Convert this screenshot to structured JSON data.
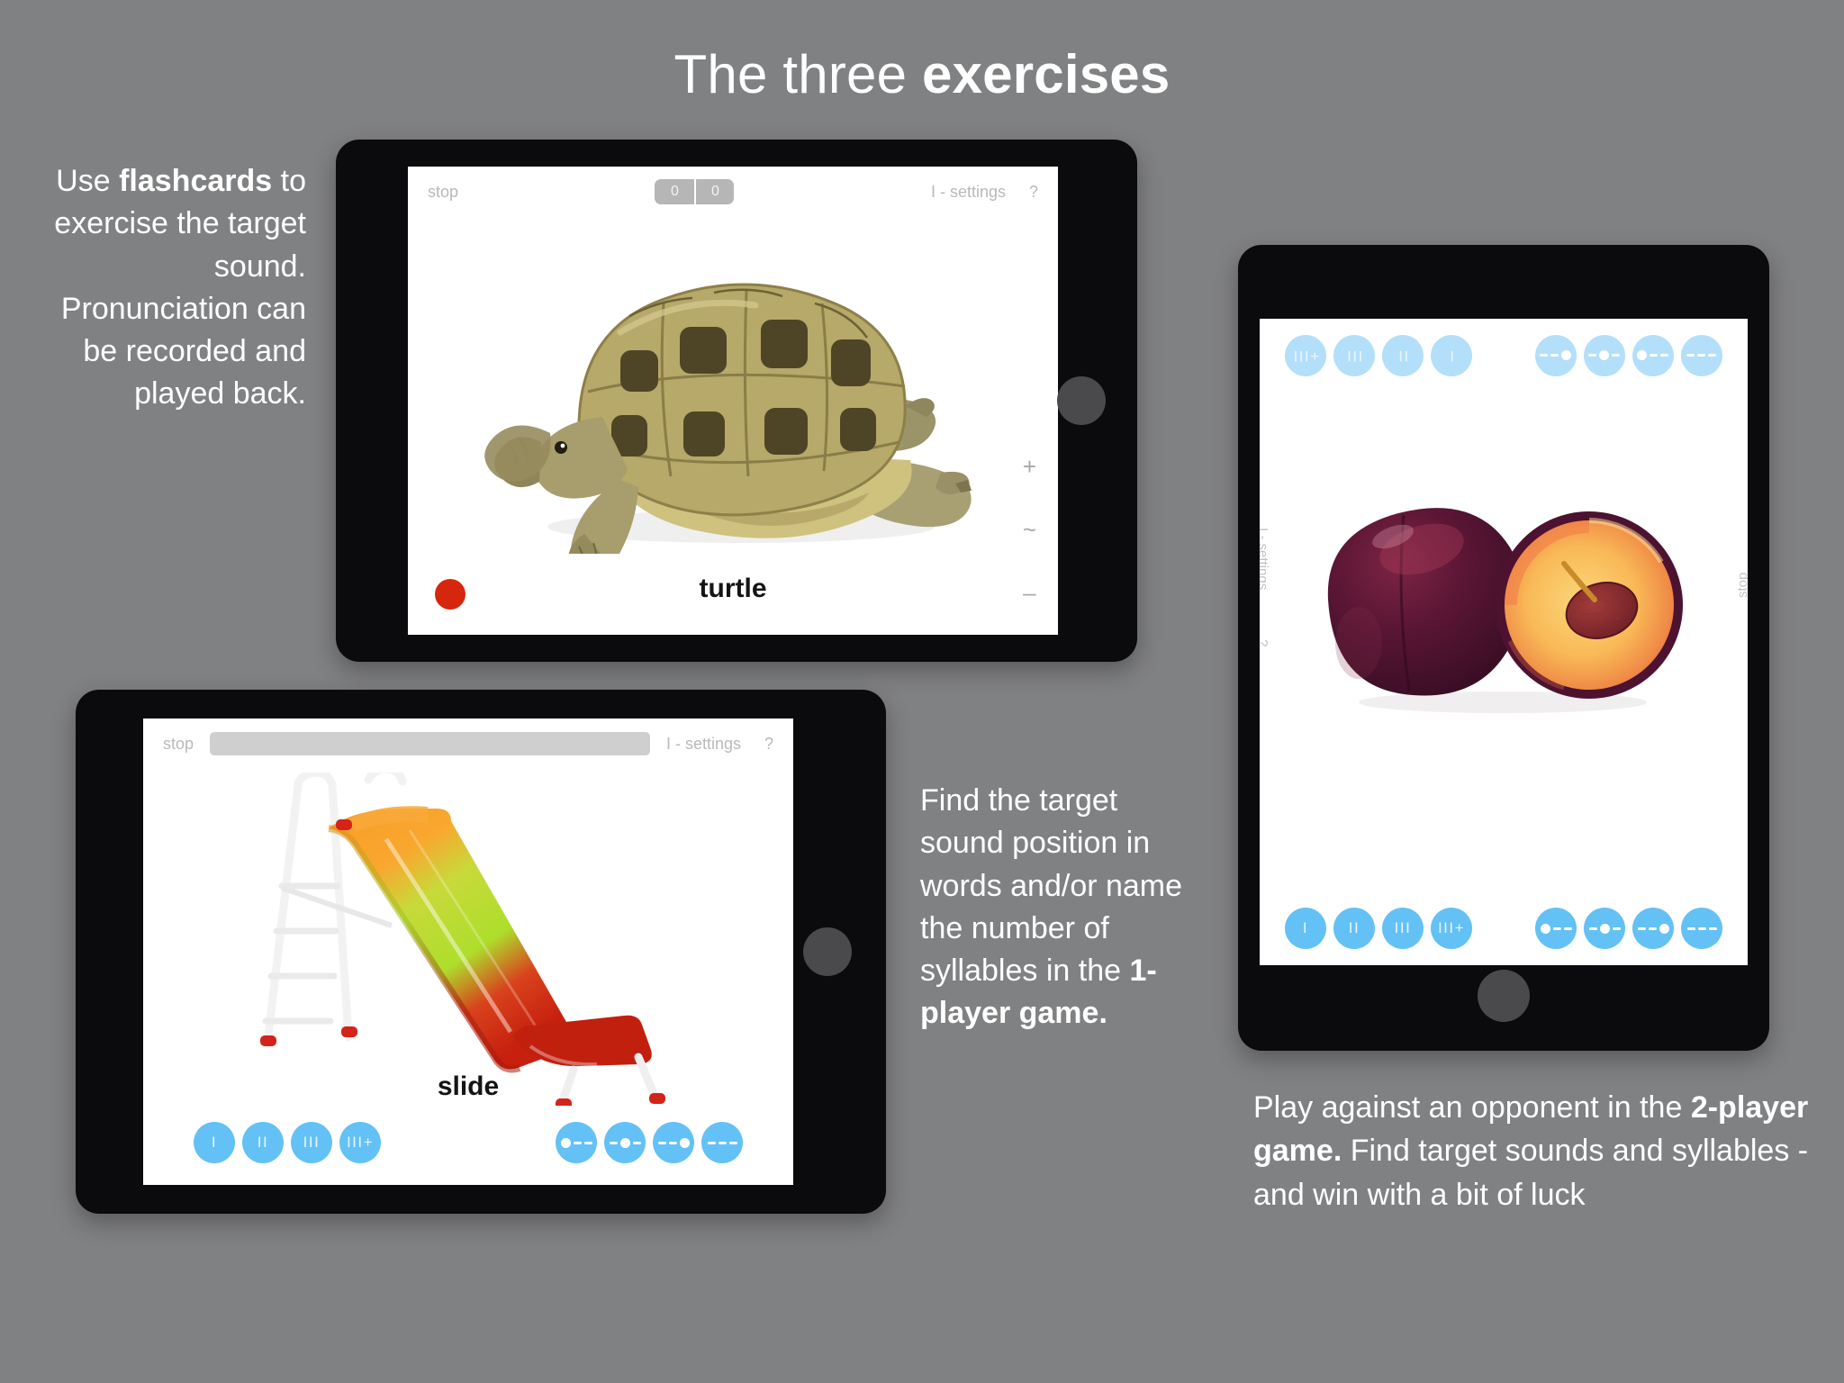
{
  "slide": {
    "title_light": "The three ",
    "title_bold": "exercises",
    "background_color": "#808183"
  },
  "captions": {
    "flashcards": {
      "part1": "Use ",
      "bold1": "flashcards",
      "part2": " to exercise the target sound. Pronunciation can be recorded and played back."
    },
    "one_player": {
      "part1": "Find the target sound position in words and/or name the number of syllables in the ",
      "bold1": "1-player game."
    },
    "two_player": {
      "part1": "Play against an opponent in the  ",
      "bold1": "2-player game.",
      "part2": " Find target sounds and syllables - and win with a bit of luck"
    }
  },
  "tablet_flashcard": {
    "name": "flashcard-exercise-tablet",
    "appbar": {
      "stop": "stop",
      "score_left": "0",
      "score_right": "0",
      "settings": "I - settings",
      "help": "?"
    },
    "word_label": "turtle",
    "record_button": "record-dot",
    "side_controls": [
      "+",
      "~",
      "–"
    ],
    "image_alt": "turtle"
  },
  "tablet_game1": {
    "name": "one-player-game-tablet",
    "appbar": {
      "stop": "stop",
      "settings": "I - settings",
      "help": "?",
      "progress": "progress-bar"
    },
    "word_label": "slide",
    "image_alt": "slide",
    "syllable_buttons": [
      "I",
      "II",
      "III",
      "III+"
    ],
    "position_buttons": [
      "initial",
      "medial",
      "final",
      "none"
    ]
  },
  "tablet_game2": {
    "name": "two-player-game-tablet",
    "side_labels": {
      "settings": "I - settings",
      "help": "?",
      "stop": "stop"
    },
    "image_alt": "plums",
    "top_position_buttons": [
      "none",
      "initial",
      "medial",
      "final"
    ],
    "top_syllable_buttons": [
      "+III",
      "III",
      "II",
      "I"
    ],
    "bottom_syllable_buttons": [
      "I",
      "II",
      "III",
      "III+"
    ],
    "bottom_position_buttons": [
      "initial",
      "medial",
      "final",
      "none"
    ]
  },
  "colors": {
    "button_blue": "#63c1f5",
    "button_blue_light": "#b3dffa",
    "record_red": "#d6260d",
    "bezel": "#0b0b0d",
    "chrome_gray": "#b9b9b9"
  }
}
